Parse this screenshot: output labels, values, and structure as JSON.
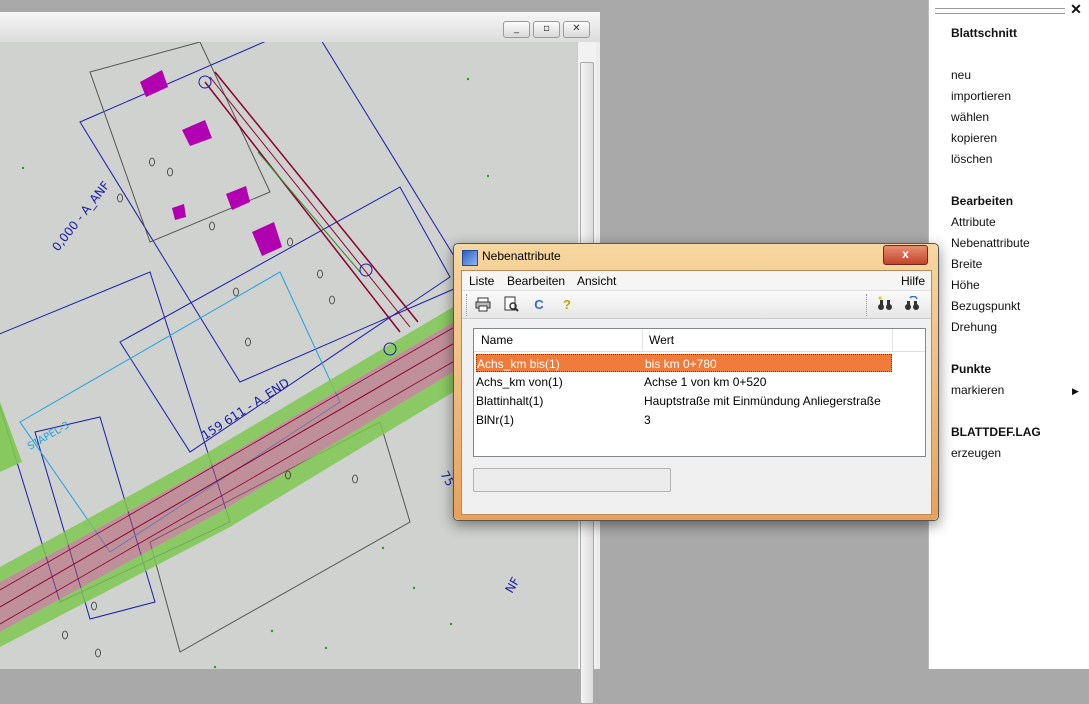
{
  "map_window": {
    "buttons": {
      "minimize": "_",
      "restore": "▫",
      "close": "✕"
    },
    "labels": [
      "0,000 - A_ANF",
      "159 611 - A_END",
      "STAPEL-3",
      "NF",
      "75"
    ]
  },
  "side_panel": {
    "close_label": "✕",
    "sections": [
      {
        "heading": "Blattschnitt",
        "items": [
          "neu",
          "importieren",
          "wählen",
          "kopieren",
          "löschen"
        ]
      },
      {
        "heading": "Bearbeiten",
        "items": [
          "Attribute",
          "Nebenattribute",
          "Breite",
          "Höhe",
          "Bezugspunkt",
          "Drehung"
        ]
      },
      {
        "heading": "Punkte",
        "items": [
          "markieren"
        ]
      },
      {
        "heading": "BLATTDEF.LAG",
        "items": [
          "erzeugen"
        ]
      }
    ],
    "submenu_arrow": "▶"
  },
  "dialog": {
    "title": "Nebenattribute",
    "close_label": "x",
    "menu": [
      "Liste",
      "Bearbeiten",
      "Ansicht",
      "Hilfe"
    ],
    "toolbar_icons": [
      "printer-icon",
      "print-preview-icon",
      "refresh-icon",
      "help-icon",
      "binoculars-icon",
      "binoculars-refresh-icon"
    ],
    "columns": [
      "Name",
      "Wert"
    ],
    "rows": [
      {
        "name": "Achs_km bis(1)",
        "value": "bis km 0+780"
      },
      {
        "name": "Achs_km von(1)",
        "value": "Achse 1 von km 0+520"
      },
      {
        "name": "Blattinhalt(1)",
        "value": "Hauptstraße mit Einmündung Anliegerstraße"
      },
      {
        "name": "BlNr(1)",
        "value": "3"
      }
    ],
    "selected_row": 0,
    "status_value": ""
  },
  "colors": {
    "accent": "#f07b3a",
    "road": "#8b0030",
    "verge": "#7ec850",
    "building": "#b000b0"
  }
}
